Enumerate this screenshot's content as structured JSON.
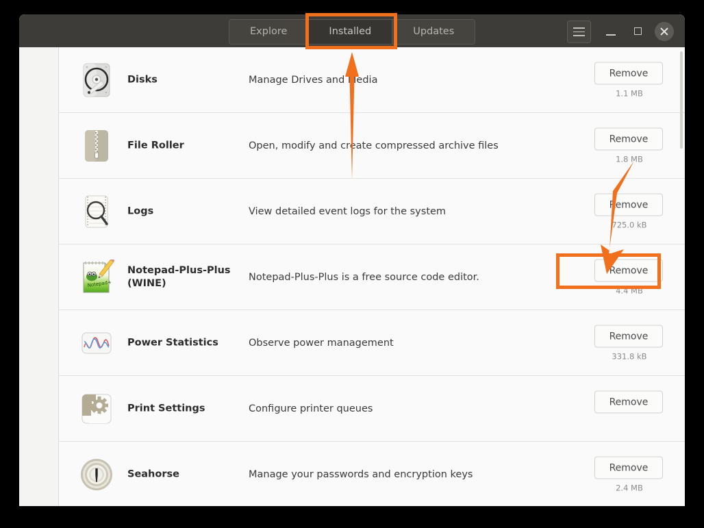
{
  "window": {
    "titlebar": {
      "tabs": [
        {
          "label": "Explore",
          "active": false,
          "name": "tab-explore"
        },
        {
          "label": "Installed",
          "active": true,
          "name": "tab-installed"
        },
        {
          "label": "Updates",
          "active": false,
          "name": "tab-updates"
        }
      ],
      "menu_icon": "hamburger-menu-icon",
      "minimize_icon": "minimize-icon",
      "maximize_icon": "maximize-icon",
      "close_icon": "close-icon"
    }
  },
  "colors": {
    "accent_annotation": "#f0701e",
    "titlebar_bg": "#3d3c38",
    "tab_active_bg": "#373531",
    "content_bg": "#fafafa"
  },
  "apps": [
    {
      "name": "Disks",
      "description": "Manage Drives and Media",
      "action_label": "Remove",
      "size": "1.1 MB",
      "icon": "hard-disk-icon"
    },
    {
      "name": "File Roller",
      "description": "Open, modify and create compressed archive files",
      "action_label": "Remove",
      "size": "1.8 MB",
      "icon": "archive-bag-icon"
    },
    {
      "name": "Logs",
      "description": "View detailed event logs for the system",
      "action_label": "Remove",
      "size": "725.0 kB",
      "icon": "magnifier-document-icon"
    },
    {
      "name": "Notepad-Plus-Plus (WINE)",
      "description": "Notepad-Plus-Plus is a free source code editor.",
      "action_label": "Remove",
      "size": "4.4 MB",
      "icon": "notepad-pencil-icon"
    },
    {
      "name": "Power Statistics",
      "description": "Observe power management",
      "action_label": "Remove",
      "size": "331.8 kB",
      "icon": "waveform-chart-icon"
    },
    {
      "name": "Print Settings",
      "description": "Configure printer queues",
      "action_label": "Remove",
      "size": "",
      "icon": "gears-icon"
    },
    {
      "name": "Seahorse",
      "description": "Manage your passwords and encryption keys",
      "action_label": "Remove",
      "size": "2.4 MB",
      "icon": "keyring-lock-icon"
    }
  ],
  "annotations": {
    "highlight_installed_tab": "installed-tab-highlight",
    "highlight_remove_button": "notepad-remove-button-highlight",
    "arrow_up": "arrow-pointing-to-installed-tab",
    "arrow_diagonal": "arrow-pointing-to-remove-button"
  }
}
